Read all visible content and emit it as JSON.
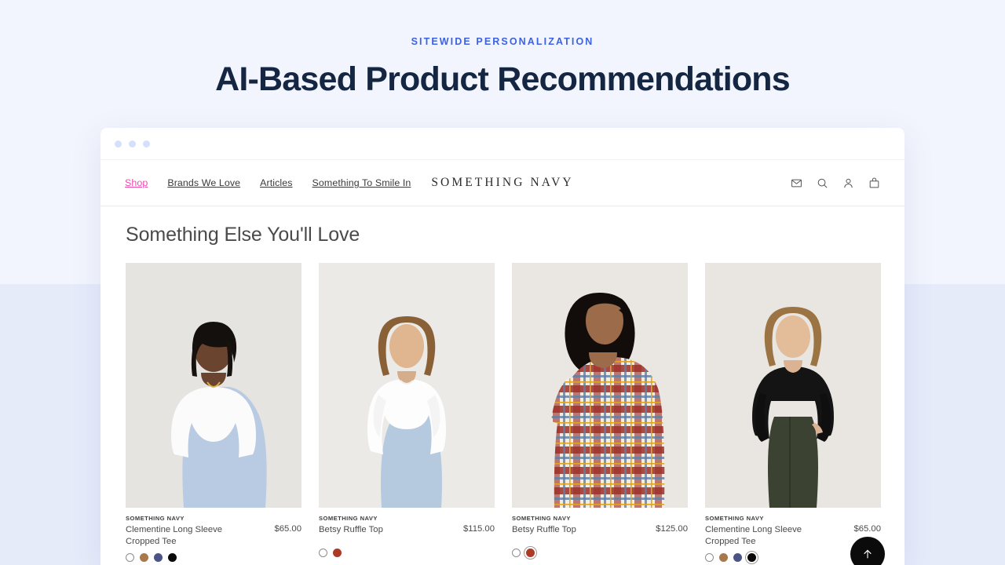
{
  "hero": {
    "eyebrow": "SITEWIDE PERSONALIZATION",
    "headline": "AI-Based Product Recommendations",
    "eyebrow_color": "#3d62e0",
    "headline_color": "#152642"
  },
  "background": {
    "top_color": "#f2f5fd",
    "bottom_color": "#e6ebfa"
  },
  "browser": {
    "dots": [
      "dot-1",
      "dot-2",
      "dot-3"
    ],
    "dot_color": "#d6dffb"
  },
  "site": {
    "brand": "SOMETHING NAVY",
    "nav": [
      {
        "label": "Shop",
        "active": true,
        "name": "nav-shop"
      },
      {
        "label": "Brands We Love",
        "active": false,
        "name": "nav-brands-we-love"
      },
      {
        "label": "Articles",
        "active": false,
        "name": "nav-articles"
      },
      {
        "label": "Something To Smile In",
        "active": false,
        "name": "nav-something-to-smile-in"
      }
    ],
    "active_color": "#ee4bb0",
    "icons": [
      {
        "name": "envelope-icon",
        "label": "Email"
      },
      {
        "name": "search-icon",
        "label": "Search"
      },
      {
        "name": "user-icon",
        "label": "Account"
      },
      {
        "name": "bag-icon",
        "label": "Cart"
      }
    ]
  },
  "section": {
    "title": "Something Else You'll Love"
  },
  "products": [
    {
      "brand": "SOMETHING NAVY",
      "name": "Clementine Long Sleeve Cropped Tee",
      "price": "$65.00",
      "photo": "woman-white-longsleeve-blue-jeans",
      "swatches": [
        {
          "color": "#ffffff",
          "outline": true,
          "selected": false,
          "name": "swatch-white"
        },
        {
          "color": "#a8794d",
          "outline": false,
          "selected": false,
          "name": "swatch-tan"
        },
        {
          "color": "#4b5585",
          "outline": false,
          "selected": false,
          "name": "swatch-navy"
        },
        {
          "color": "#0a0a0a",
          "outline": false,
          "selected": false,
          "name": "swatch-black"
        }
      ]
    },
    {
      "brand": "SOMETHING NAVY",
      "name": "Betsy Ruffle Top",
      "price": "$115.00",
      "photo": "woman-white-ruffle-blouse-jeans",
      "swatches": [
        {
          "color": "#ffffff",
          "outline": true,
          "selected": false,
          "name": "swatch-white"
        },
        {
          "color": "#ab3b27",
          "outline": false,
          "selected": false,
          "name": "swatch-rust"
        }
      ]
    },
    {
      "brand": "SOMETHING NAVY",
      "name": "Betsy Ruffle Top",
      "price": "$125.00",
      "photo": "woman-plaid-ruffle-top-back",
      "swatches": [
        {
          "color": "#ffffff",
          "outline": true,
          "selected": false,
          "name": "swatch-white"
        },
        {
          "color": "#ab3b27",
          "outline": false,
          "selected": true,
          "name": "swatch-rust"
        }
      ]
    },
    {
      "brand": "SOMETHING NAVY",
      "name": "Clementine Long Sleeve Cropped Tee",
      "price": "$65.00",
      "photo": "woman-black-top-olive-pants",
      "swatches": [
        {
          "color": "#ffffff",
          "outline": true,
          "selected": false,
          "name": "swatch-white"
        },
        {
          "color": "#a8794d",
          "outline": false,
          "selected": false,
          "name": "swatch-tan"
        },
        {
          "color": "#4b5585",
          "outline": false,
          "selected": false,
          "name": "swatch-navy"
        },
        {
          "color": "#0a0a0a",
          "outline": false,
          "selected": true,
          "name": "swatch-black"
        }
      ]
    }
  ],
  "scroll_to_top": {
    "name": "scroll-to-top-button",
    "icon": "arrow-up-icon",
    "color": "#0b0b0b"
  }
}
